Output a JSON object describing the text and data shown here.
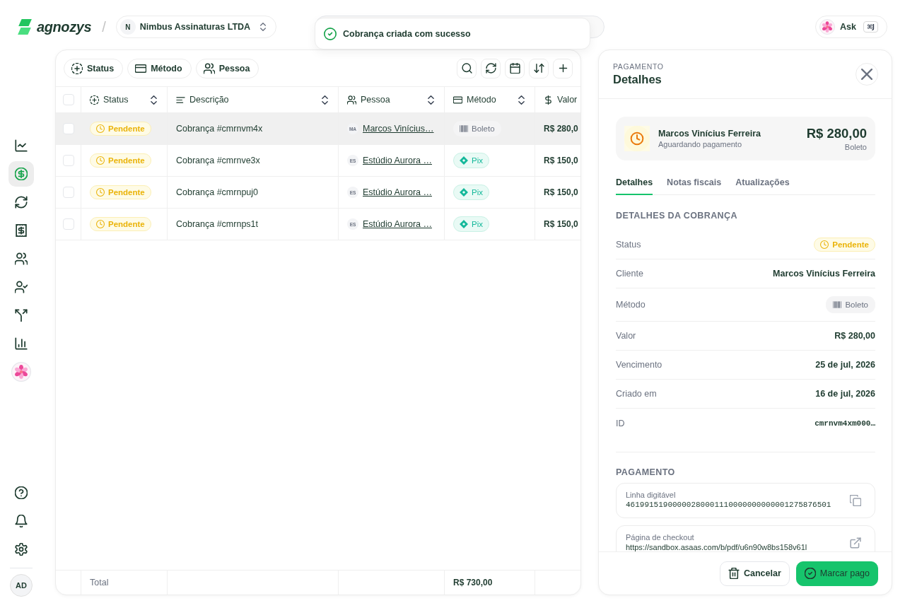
{
  "brand": {
    "name": "agnozys"
  },
  "breadcrumb_separator": "/",
  "organization": {
    "initial": "N",
    "name": "Nimbus Assinaturas LTDA"
  },
  "toast": {
    "message": "Cobrança criada com sucesso"
  },
  "ask": {
    "label": "Ask",
    "shortcut": "⌘J"
  },
  "sidebar": {
    "items": [
      {
        "kind": "icon",
        "selected": false
      },
      {
        "kind": "icon",
        "selected": true
      },
      {
        "kind": "icon",
        "selected": false
      },
      {
        "kind": "icon",
        "selected": false
      },
      {
        "kind": "icon",
        "selected": false
      },
      {
        "kind": "icon",
        "selected": false
      },
      {
        "kind": "icon",
        "selected": false
      },
      {
        "kind": "icon",
        "selected": false
      },
      {
        "kind": "avatar",
        "selected": false
      }
    ],
    "user": {
      "initials": "AD"
    }
  },
  "filters": [
    {
      "label": "Status"
    },
    {
      "label": "Método"
    },
    {
      "label": "Pessoa"
    }
  ],
  "table": {
    "select_all": {
      "checked": false
    },
    "columns": [
      {
        "label": "Status",
        "sortable": true
      },
      {
        "label": "Descrição",
        "sortable": true
      },
      {
        "label": "Pessoa",
        "sortable": true
      },
      {
        "label": "Método",
        "sortable": true
      },
      {
        "label": "Valor",
        "sortable": false
      }
    ],
    "rows": [
      {
        "selected": true,
        "checked": false,
        "status": {
          "kind": "pending",
          "label": "Pendente"
        },
        "description": "Cobrança #cmrnvm4x",
        "person": {
          "initials": "MA",
          "name": "Marcos Vinícius…"
        },
        "method": {
          "kind": "boleto",
          "label": "Boleto"
        },
        "value": "R$ 280,0"
      },
      {
        "selected": false,
        "checked": false,
        "status": {
          "kind": "pending",
          "label": "Pendente"
        },
        "description": "Cobrança #cmrnve3x",
        "person": {
          "initials": "ES",
          "name": "Estúdio Aurora …"
        },
        "method": {
          "kind": "pix",
          "label": "Pix"
        },
        "value": "R$ 150,0"
      },
      {
        "selected": false,
        "checked": false,
        "status": {
          "kind": "pending",
          "label": "Pendente"
        },
        "description": "Cobrança #cmrnpuj0",
        "person": {
          "initials": "ES",
          "name": "Estúdio Aurora …"
        },
        "method": {
          "kind": "pix",
          "label": "Pix"
        },
        "value": "R$ 150,0"
      },
      {
        "selected": false,
        "checked": false,
        "status": {
          "kind": "pending",
          "label": "Pendente"
        },
        "description": "Cobrança #cmrnps1t",
        "person": {
          "initials": "ES",
          "name": "Estúdio Aurora …"
        },
        "method": {
          "kind": "pix",
          "label": "Pix"
        },
        "value": "R$ 150,0"
      }
    ],
    "footer": {
      "label": "Total",
      "method_total": "R$ 730,00"
    }
  },
  "detail": {
    "eyebrow": "PAGAMENTO",
    "title": "Detalhes",
    "summary": {
      "kind": "pending",
      "name": "Marcos Vinícius Ferreira",
      "status_text": "Aguardando pagamento",
      "amount": "R$ 280,00",
      "method": "Boleto"
    },
    "tabs": [
      {
        "label": "Detalhes",
        "selected": true
      },
      {
        "label": "Notas fiscais",
        "selected": false
      },
      {
        "label": "Atualizações",
        "selected": false
      }
    ],
    "section_title": "DETALHES DA COBRANÇA",
    "fields": [
      {
        "kind": "status",
        "label": "Status",
        "badge": {
          "kind": "pending",
          "label": "Pendente"
        }
      },
      {
        "kind": "text",
        "label": "Cliente",
        "value": "Marcos Vinícius Ferreira"
      },
      {
        "kind": "method",
        "label": "Método",
        "badge": {
          "kind": "boleto",
          "label": "Boleto"
        }
      },
      {
        "kind": "text",
        "label": "Valor",
        "value": "R$ 280,00"
      },
      {
        "kind": "text",
        "label": "Vencimento",
        "value": "25 de jul, 2026"
      },
      {
        "kind": "text",
        "label": "Criado em",
        "value": "16 de jul, 2026"
      },
      {
        "kind": "mono",
        "label": "ID",
        "value": "cmrnvm4xm000…"
      }
    ],
    "payment_title": "PAGAMENTO",
    "payment_items": [
      {
        "kind": "copy",
        "label": "Linha digitável",
        "value": "46199151900000280001110000000000001275876501"
      },
      {
        "kind": "link",
        "label": "Página de checkout",
        "value": "https://sandbox.asaas.com/b/pdf/u6n90w8bs158v61l"
      }
    ],
    "actions": [
      {
        "kind": "secondary",
        "label": "Cancelar"
      },
      {
        "kind": "primary",
        "label": "Marcar pago"
      }
    ]
  }
}
